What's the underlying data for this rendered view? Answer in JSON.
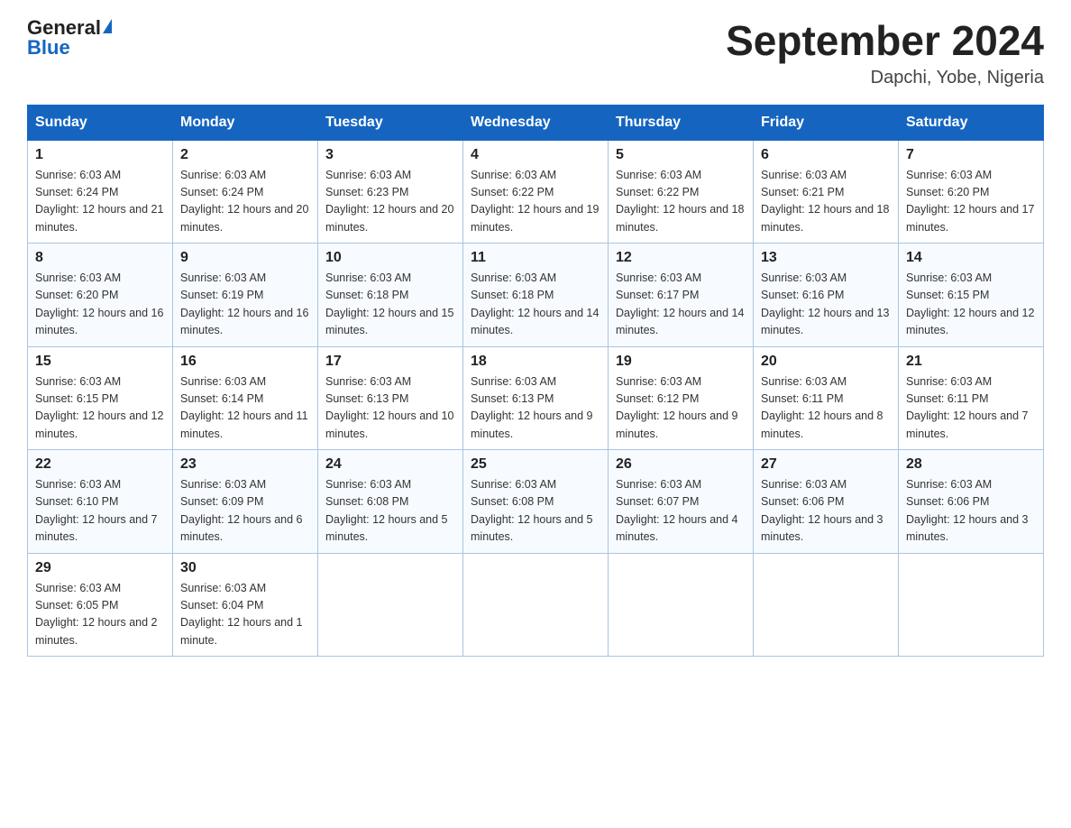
{
  "header": {
    "logo_general": "General",
    "logo_blue": "Blue",
    "month_year": "September 2024",
    "location": "Dapchi, Yobe, Nigeria"
  },
  "days_of_week": [
    "Sunday",
    "Monday",
    "Tuesday",
    "Wednesday",
    "Thursday",
    "Friday",
    "Saturday"
  ],
  "weeks": [
    [
      {
        "day": "1",
        "sunrise": "6:03 AM",
        "sunset": "6:24 PM",
        "daylight": "12 hours and 21 minutes."
      },
      {
        "day": "2",
        "sunrise": "6:03 AM",
        "sunset": "6:24 PM",
        "daylight": "12 hours and 20 minutes."
      },
      {
        "day": "3",
        "sunrise": "6:03 AM",
        "sunset": "6:23 PM",
        "daylight": "12 hours and 20 minutes."
      },
      {
        "day": "4",
        "sunrise": "6:03 AM",
        "sunset": "6:22 PM",
        "daylight": "12 hours and 19 minutes."
      },
      {
        "day": "5",
        "sunrise": "6:03 AM",
        "sunset": "6:22 PM",
        "daylight": "12 hours and 18 minutes."
      },
      {
        "day": "6",
        "sunrise": "6:03 AM",
        "sunset": "6:21 PM",
        "daylight": "12 hours and 18 minutes."
      },
      {
        "day": "7",
        "sunrise": "6:03 AM",
        "sunset": "6:20 PM",
        "daylight": "12 hours and 17 minutes."
      }
    ],
    [
      {
        "day": "8",
        "sunrise": "6:03 AM",
        "sunset": "6:20 PM",
        "daylight": "12 hours and 16 minutes."
      },
      {
        "day": "9",
        "sunrise": "6:03 AM",
        "sunset": "6:19 PM",
        "daylight": "12 hours and 16 minutes."
      },
      {
        "day": "10",
        "sunrise": "6:03 AM",
        "sunset": "6:18 PM",
        "daylight": "12 hours and 15 minutes."
      },
      {
        "day": "11",
        "sunrise": "6:03 AM",
        "sunset": "6:18 PM",
        "daylight": "12 hours and 14 minutes."
      },
      {
        "day": "12",
        "sunrise": "6:03 AM",
        "sunset": "6:17 PM",
        "daylight": "12 hours and 14 minutes."
      },
      {
        "day": "13",
        "sunrise": "6:03 AM",
        "sunset": "6:16 PM",
        "daylight": "12 hours and 13 minutes."
      },
      {
        "day": "14",
        "sunrise": "6:03 AM",
        "sunset": "6:15 PM",
        "daylight": "12 hours and 12 minutes."
      }
    ],
    [
      {
        "day": "15",
        "sunrise": "6:03 AM",
        "sunset": "6:15 PM",
        "daylight": "12 hours and 12 minutes."
      },
      {
        "day": "16",
        "sunrise": "6:03 AM",
        "sunset": "6:14 PM",
        "daylight": "12 hours and 11 minutes."
      },
      {
        "day": "17",
        "sunrise": "6:03 AM",
        "sunset": "6:13 PM",
        "daylight": "12 hours and 10 minutes."
      },
      {
        "day": "18",
        "sunrise": "6:03 AM",
        "sunset": "6:13 PM",
        "daylight": "12 hours and 9 minutes."
      },
      {
        "day": "19",
        "sunrise": "6:03 AM",
        "sunset": "6:12 PM",
        "daylight": "12 hours and 9 minutes."
      },
      {
        "day": "20",
        "sunrise": "6:03 AM",
        "sunset": "6:11 PM",
        "daylight": "12 hours and 8 minutes."
      },
      {
        "day": "21",
        "sunrise": "6:03 AM",
        "sunset": "6:11 PM",
        "daylight": "12 hours and 7 minutes."
      }
    ],
    [
      {
        "day": "22",
        "sunrise": "6:03 AM",
        "sunset": "6:10 PM",
        "daylight": "12 hours and 7 minutes."
      },
      {
        "day": "23",
        "sunrise": "6:03 AM",
        "sunset": "6:09 PM",
        "daylight": "12 hours and 6 minutes."
      },
      {
        "day": "24",
        "sunrise": "6:03 AM",
        "sunset": "6:08 PM",
        "daylight": "12 hours and 5 minutes."
      },
      {
        "day": "25",
        "sunrise": "6:03 AM",
        "sunset": "6:08 PM",
        "daylight": "12 hours and 5 minutes."
      },
      {
        "day": "26",
        "sunrise": "6:03 AM",
        "sunset": "6:07 PM",
        "daylight": "12 hours and 4 minutes."
      },
      {
        "day": "27",
        "sunrise": "6:03 AM",
        "sunset": "6:06 PM",
        "daylight": "12 hours and 3 minutes."
      },
      {
        "day": "28",
        "sunrise": "6:03 AM",
        "sunset": "6:06 PM",
        "daylight": "12 hours and 3 minutes."
      }
    ],
    [
      {
        "day": "29",
        "sunrise": "6:03 AM",
        "sunset": "6:05 PM",
        "daylight": "12 hours and 2 minutes."
      },
      {
        "day": "30",
        "sunrise": "6:03 AM",
        "sunset": "6:04 PM",
        "daylight": "12 hours and 1 minute."
      },
      null,
      null,
      null,
      null,
      null
    ]
  ]
}
